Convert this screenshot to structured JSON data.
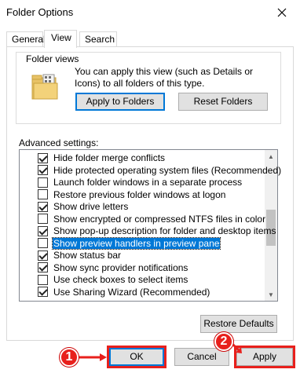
{
  "window": {
    "title": "Folder Options"
  },
  "tabs": [
    {
      "label": "General"
    },
    {
      "label": "View"
    },
    {
      "label": "Search"
    }
  ],
  "folder_views": {
    "legend": "Folder views",
    "description": "You can apply this view (such as Details or Icons) to all folders of this type.",
    "apply_button": "Apply to Folders",
    "reset_button": "Reset Folders"
  },
  "advanced": {
    "label": "Advanced settings:",
    "items": [
      {
        "label": "Hide folder merge conflicts",
        "checked": true
      },
      {
        "label": "Hide protected operating system files (Recommended)",
        "checked": true
      },
      {
        "label": "Launch folder windows in a separate process",
        "checked": false
      },
      {
        "label": "Restore previous folder windows at logon",
        "checked": false
      },
      {
        "label": "Show drive letters",
        "checked": true
      },
      {
        "label": "Show encrypted or compressed NTFS files in color",
        "checked": false
      },
      {
        "label": "Show pop-up description for folder and desktop items",
        "checked": true
      },
      {
        "label": "Show preview handlers in preview pane",
        "checked": false,
        "selected": true
      },
      {
        "label": "Show status bar",
        "checked": true
      },
      {
        "label": "Show sync provider notifications",
        "checked": true
      },
      {
        "label": "Use check boxes to select items",
        "checked": false
      },
      {
        "label": "Use Sharing Wizard (Recommended)",
        "checked": true
      }
    ],
    "restore_button": "Restore Defaults"
  },
  "footer": {
    "ok": "OK",
    "cancel": "Cancel",
    "apply": "Apply"
  },
  "annotations": {
    "step1": "1",
    "step2": "2"
  },
  "colors": {
    "accent": "#0078d7",
    "annotation": "#e8201c"
  }
}
